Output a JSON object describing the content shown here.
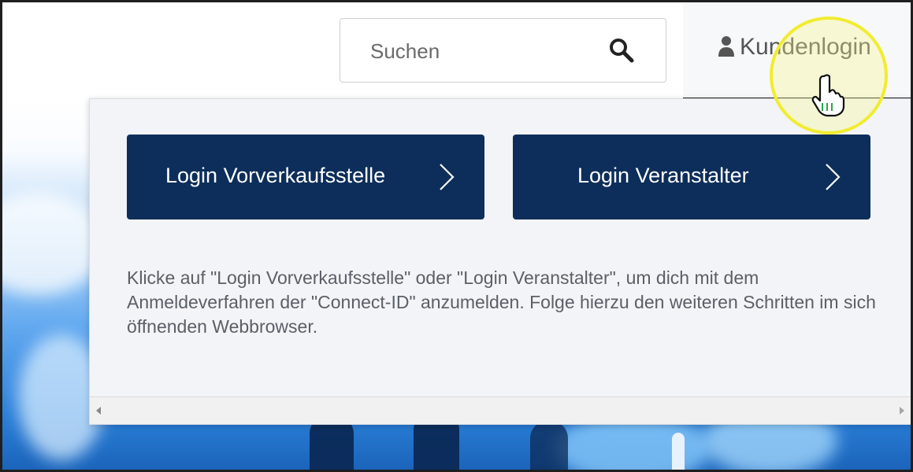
{
  "header": {
    "search": {
      "placeholder": "Suchen",
      "icon": "search-icon"
    },
    "account_tab": {
      "label": "Kundenlogin",
      "icon": "user-icon",
      "active": true
    }
  },
  "login_dropdown": {
    "buttons": [
      {
        "label": "Login Vorverkaufsstelle",
        "icon": "chevron-right-icon"
      },
      {
        "label": "Login Veranstalter",
        "icon": "chevron-right-icon"
      }
    ],
    "info_text": "Klicke auf \"Login Vorverkaufsstelle\" oder \"Login Veranstalter\", um dich mit dem Anmeldeverfahren der \"Connect-ID\" anzumelden. Folge hierzu den weiteren Schritten im sich öffnenden Webbrowser."
  },
  "colors": {
    "button_background": "#0d2e5a",
    "button_text": "#ffffff",
    "cursor_highlight": "#f1ec2f",
    "panel_background": "#f2f4f7"
  }
}
